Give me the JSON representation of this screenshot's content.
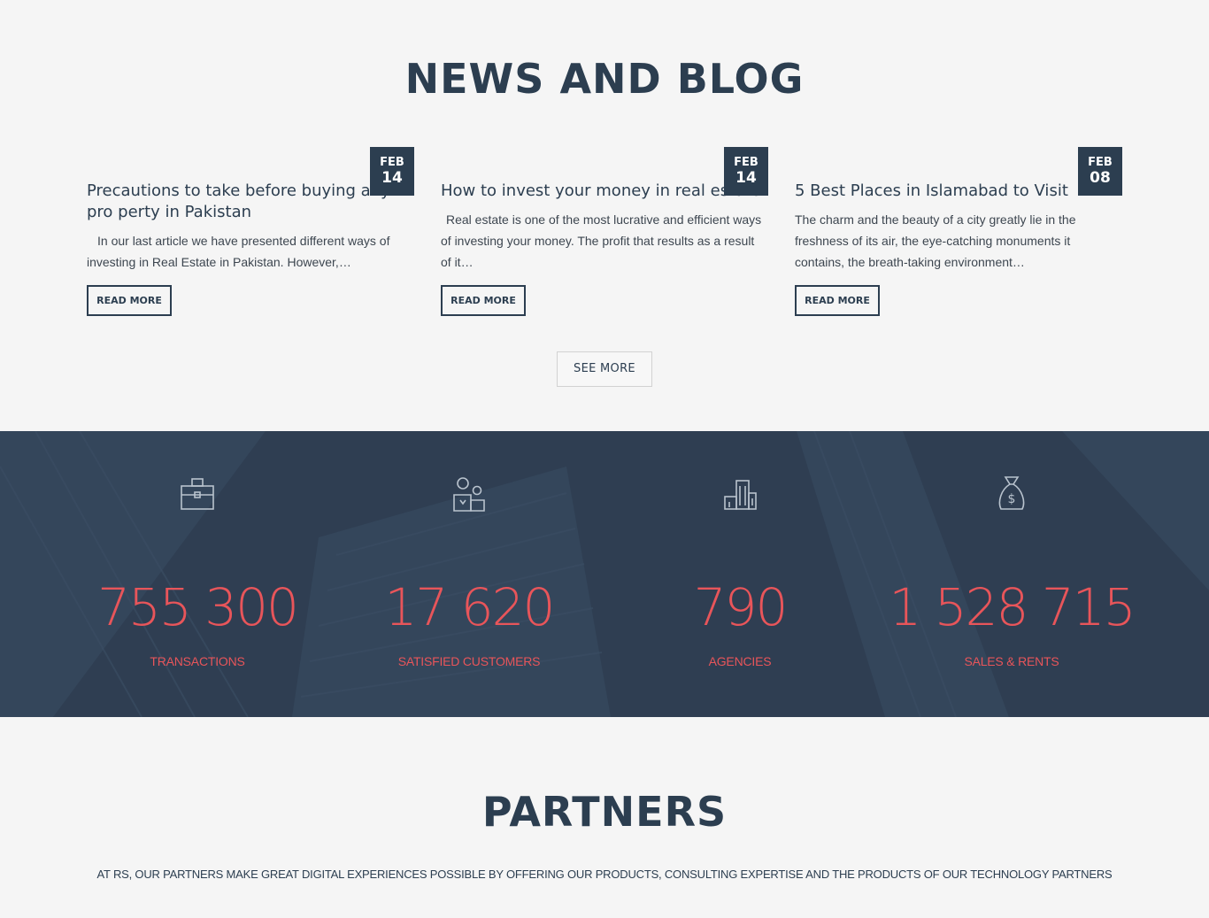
{
  "news": {
    "title": "NEWS AND BLOG",
    "posts": [
      {
        "month": "FEB",
        "day": "14",
        "title": "Precautions to take before buying any pro perty in Pakistan",
        "excerpt": "In our last article we have presented different ways of investing in Real Estate in Pakistan. However,…",
        "button": "READ MORE"
      },
      {
        "month": "FEB",
        "day": "14",
        "title": "How to invest your money in real estate",
        "excerpt": "Real estate is one of the most lucrative and efficient ways of investing your money. The profit that results as a result of it…",
        "button": "READ MORE"
      },
      {
        "month": "FEB",
        "day": "08",
        "title": "5 Best Places in Islamabad to Visit",
        "excerpt": "The charm and the beauty of a city greatly lie in the freshness of its air, the eye-catching monuments it contains, the breath-taking environment…",
        "button": "READ MORE"
      }
    ],
    "see_more": "SEE MORE"
  },
  "stats": [
    {
      "icon": "briefcase-icon",
      "value": "755 300",
      "label": "TRANSACTIONS"
    },
    {
      "icon": "customers-icon",
      "value": "17 620",
      "label": "SATISFIED CUSTOMERS"
    },
    {
      "icon": "building-icon",
      "value": "790",
      "label": "AGENCIES"
    },
    {
      "icon": "money-bag-icon",
      "value": "1 528 715",
      "label": "SALES & RENTS"
    }
  ],
  "partners": {
    "title": "PARTNERS",
    "description": "AT RS, OUR PARTNERS MAKE GREAT DIGITAL EXPERIENCES POSSIBLE BY OFFERING OUR PRODUCTS, CONSULTING EXPERTISE AND THE PRODUCTS OF OUR TECHNOLOGY PARTNERS"
  },
  "colors": {
    "primary": "#2c3e50",
    "accent": "#e8555a",
    "background": "#f5f5f5"
  }
}
